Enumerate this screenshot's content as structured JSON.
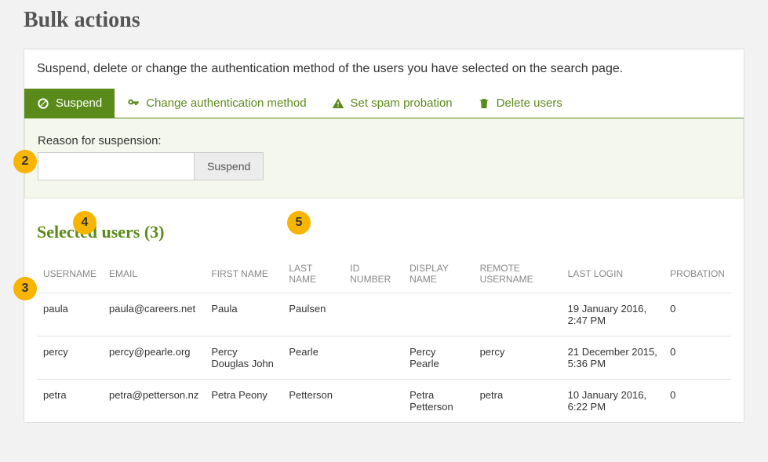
{
  "title": "Bulk actions",
  "intro": "Suspend, delete or change the authentication method of the users you have selected on the search page.",
  "tabs": [
    {
      "label": "Suspend",
      "active": true
    },
    {
      "label": "Change authentication method",
      "active": false
    },
    {
      "label": "Set spam probation",
      "active": false
    },
    {
      "label": "Delete users",
      "active": false
    }
  ],
  "form": {
    "reason_label": "Reason for suspension:",
    "reason_value": "",
    "submit_label": "Suspend"
  },
  "selected_users_title": "Selected users (3)",
  "table": {
    "headers": [
      "USERNAME",
      "EMAIL",
      "FIRST NAME",
      "LAST NAME",
      "ID NUMBER",
      "DISPLAY NAME",
      "REMOTE USERNAME",
      "LAST LOGIN",
      "PROBATION"
    ],
    "rows": [
      {
        "username": "paula",
        "email": "paula@careers.net",
        "first": "Paula",
        "last": "Paulsen",
        "id": "",
        "display": "",
        "remote": "",
        "last_login": "19 January 2016, 2:47 PM",
        "probation": "0"
      },
      {
        "username": "percy",
        "email": "percy@pearle.org",
        "first": "Percy Douglas John",
        "last": "Pearle",
        "id": "",
        "display": "Percy Pearle",
        "remote": "percy",
        "last_login": "21 December 2015, 5:36 PM",
        "probation": "0"
      },
      {
        "username": "petra",
        "email": "petra@petterson.nz",
        "first": "Petra Peony",
        "last": "Petterson",
        "id": "",
        "display": "Petra Petterson",
        "remote": "petra",
        "last_login": "10 January 2016, 6:22 PM",
        "probation": "0"
      }
    ]
  },
  "markers": {
    "m2": "2",
    "m3": "3",
    "m4": "4",
    "m5": "5"
  }
}
